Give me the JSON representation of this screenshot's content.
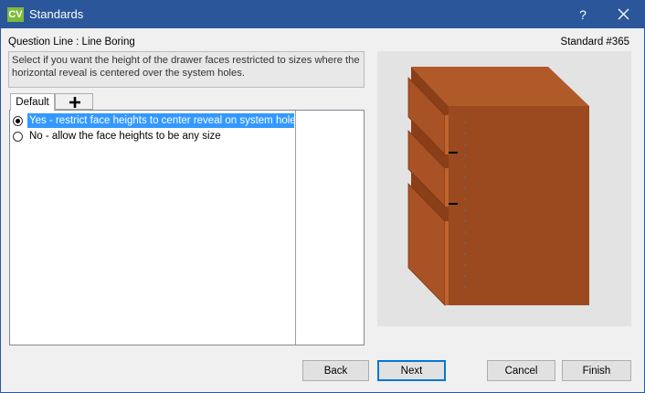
{
  "window": {
    "title": "Standards",
    "app_icon_text": "CV",
    "help_glyph": "?"
  },
  "header": {
    "question_line": "Question Line : Line Boring",
    "standard_number": "Standard #365"
  },
  "description": "Select if you want the height of the drawer faces restricted to sizes where the horizontal reveal is centered over the system holes.",
  "tabs": [
    {
      "label": "Default"
    }
  ],
  "options": [
    {
      "label": "Yes - restrict face heights to center reveal on system holes",
      "checked": true
    },
    {
      "label": "No - allow the face heights to be any size",
      "checked": false
    }
  ],
  "buttons": {
    "back": "Back",
    "next": "Next",
    "cancel": "Cancel",
    "finish": "Finish"
  },
  "colors": {
    "titlebar": "#2b579a",
    "cabinet_front": "#9a4a1e",
    "cabinet_top": "#b05a2a",
    "selection": "#3399ff"
  },
  "icons": [
    "app-icon",
    "close-icon",
    "plus-icon",
    "radio-icon"
  ]
}
